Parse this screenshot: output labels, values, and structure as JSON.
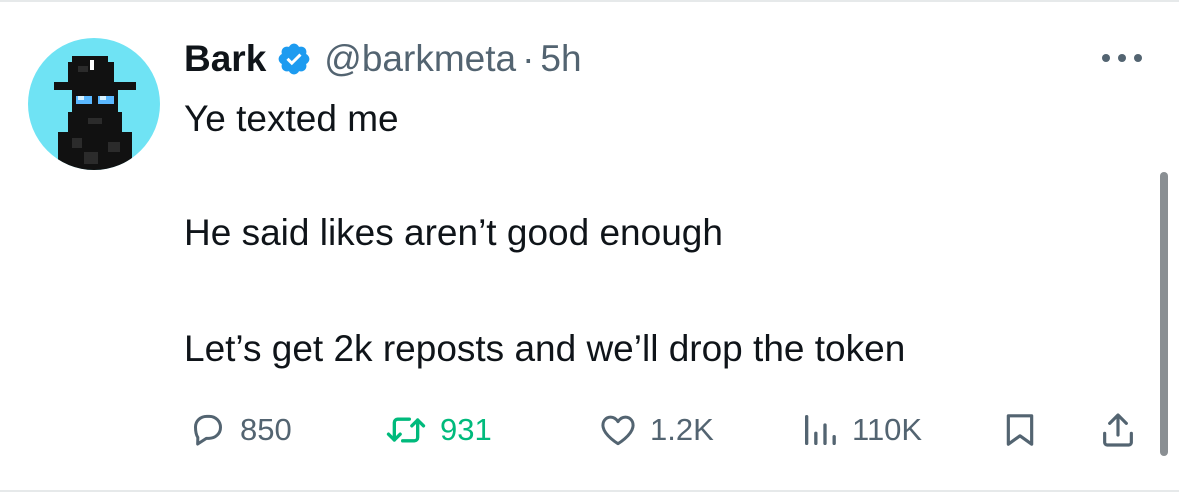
{
  "tweet": {
    "author": {
      "display_name": "Bark",
      "handle": "@barkmeta",
      "verified": true,
      "avatar_background": "#6fe3f4"
    },
    "separator": "·",
    "time": "5h",
    "lines": [
      "Ye texted me",
      "He said likes aren’t good enough",
      "Let’s get 2k reposts and we’ll drop the token"
    ],
    "metrics": {
      "replies": "850",
      "reposts": "931",
      "likes": "1.2K",
      "views": "110K"
    }
  },
  "colors": {
    "text_primary": "#0f1419",
    "text_secondary": "#536471",
    "verified_blue": "#1d9bf0",
    "repost_green": "#00ba7c"
  },
  "icons": {
    "more": "more-dots-icon",
    "verified": "verified-badge-icon",
    "reply": "reply-bubble-icon",
    "repost": "repost-arrows-icon",
    "like": "heart-icon",
    "views": "views-bars-icon",
    "bookmark": "bookmark-icon",
    "share": "share-icon"
  }
}
